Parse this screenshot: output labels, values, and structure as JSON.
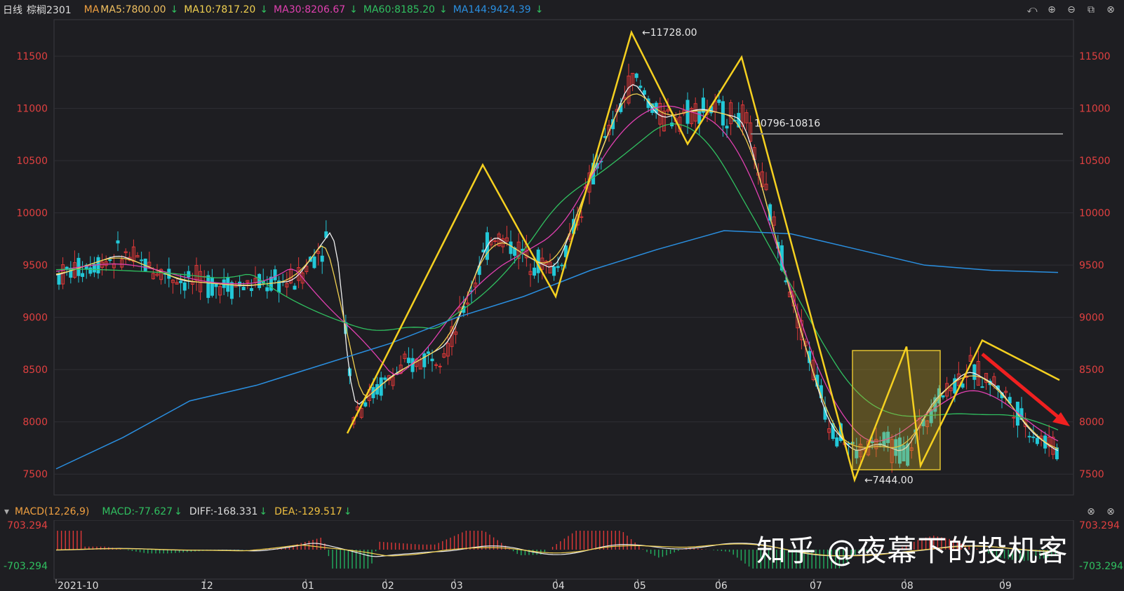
{
  "header": {
    "period": "日线",
    "symbol": "棕榈2301",
    "ma_prefix": "MA",
    "indicators": [
      {
        "label": "MA5:7800.00",
        "color": "#e8e8e8",
        "arrow": "down"
      },
      {
        "label": "MA10:7817.20",
        "color": "#f0d050",
        "arrow": "down"
      },
      {
        "label": "MA30:8206.67",
        "color": "#e040b0",
        "arrow": "down"
      },
      {
        "label": "MA60:8185.20",
        "color": "#30c060",
        "arrow": "down"
      },
      {
        "label": "MA144:9424.39",
        "color": "#2a8fe0",
        "arrow": "down"
      }
    ]
  },
  "macd_header": {
    "name": "MACD(12,26,9)",
    "macd": "MACD:-77.627",
    "diff": "DIFF:-168.331",
    "dea": "DEA:-129.517"
  },
  "watermark": "知乎 @夜幕下的投机客",
  "chart_data": {
    "type": "candlestick",
    "title": "棕榈2301",
    "ylim": [
      7300,
      11850
    ],
    "y_ticks": [
      7500,
      8000,
      8500,
      9000,
      9500,
      10000,
      10500,
      11000,
      11500
    ],
    "x_ticks": [
      "2021-10",
      "12",
      "01",
      "02",
      "03",
      "04",
      "05",
      "06",
      "07",
      "08",
      "09"
    ],
    "annotations": [
      {
        "text": "←11728.00",
        "value": 11728
      },
      {
        "text": "10796-10816",
        "value": 10806
      },
      {
        "text": "←7444.00",
        "value": 7444
      }
    ],
    "zigzag_points": [
      7890,
      10460,
      9200,
      11728,
      10660,
      11490,
      7444,
      8720,
      7580,
      8780,
      8400
    ],
    "ma144_series": [
      7550,
      7850,
      8200,
      8350,
      8550,
      8750,
      9000,
      9200,
      9450,
      9650,
      9830,
      9800,
      9650,
      9500,
      9450,
      9430
    ],
    "macd_range": [
      -703.294,
      703.294
    ],
    "macd_tick_labels": [
      "703.294",
      "-703.294"
    ]
  }
}
